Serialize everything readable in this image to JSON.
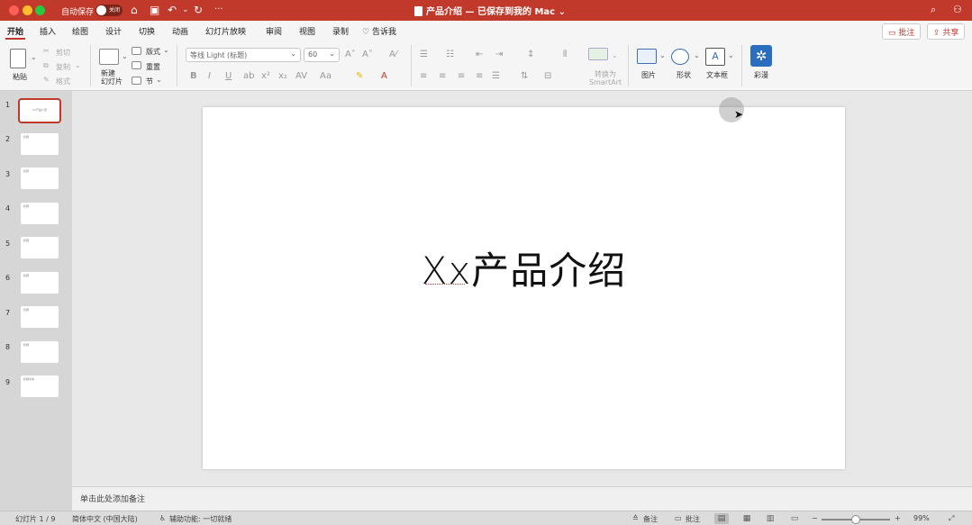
{
  "colors": {
    "accent": "#c0392b",
    "designer_blue": "#2a6ebf"
  },
  "titlebar": {
    "autosave_label": "自动保存",
    "autosave_state": "关闭",
    "more": "···",
    "doc_title": "产品介绍 — 已保存到我的 Mac",
    "chevron": "⌄"
  },
  "tabs": [
    "开始",
    "插入",
    "绘图",
    "设计",
    "切换",
    "动画",
    "幻灯片放映",
    "审阅",
    "视图",
    "录制"
  ],
  "tell_me": "告诉我",
  "comments_button": "批注",
  "share_button": "共享",
  "ribbon": {
    "paste": "粘贴",
    "cut": "剪切",
    "copy": "复制",
    "format": "格式",
    "new_slide": "新建\n幻灯片",
    "layout": "版式",
    "reset": "重置",
    "section": "节",
    "font_name": "等线 Light (标题)",
    "font_size": "60",
    "convert_smartart": "转换为\nSmartArt",
    "picture": "图片",
    "shapes": "形状",
    "textbox": "文本框",
    "designer": "彩漫"
  },
  "slides": [
    {
      "num": "1",
      "text": "Xx产品介绍"
    },
    {
      "num": "2",
      "text": "标题"
    },
    {
      "num": "3",
      "text": "标题"
    },
    {
      "num": "4",
      "text": "标题"
    },
    {
      "num": "5",
      "text": "标题"
    },
    {
      "num": "6",
      "text": "标题"
    },
    {
      "num": "7",
      "text": "标题"
    },
    {
      "num": "8",
      "text": "标题"
    },
    {
      "num": "9",
      "text": "标题文本"
    }
  ],
  "slide": {
    "title": "Xx产品介绍"
  },
  "notes_placeholder": "单击此处添加备注",
  "status": {
    "slide_count": "幻灯片 1 / 9",
    "language": "简体中文 (中国大陆)",
    "accessibility": "辅助功能: 一切就绪",
    "notes": "备注",
    "comments": "批注",
    "zoom": "99%"
  }
}
